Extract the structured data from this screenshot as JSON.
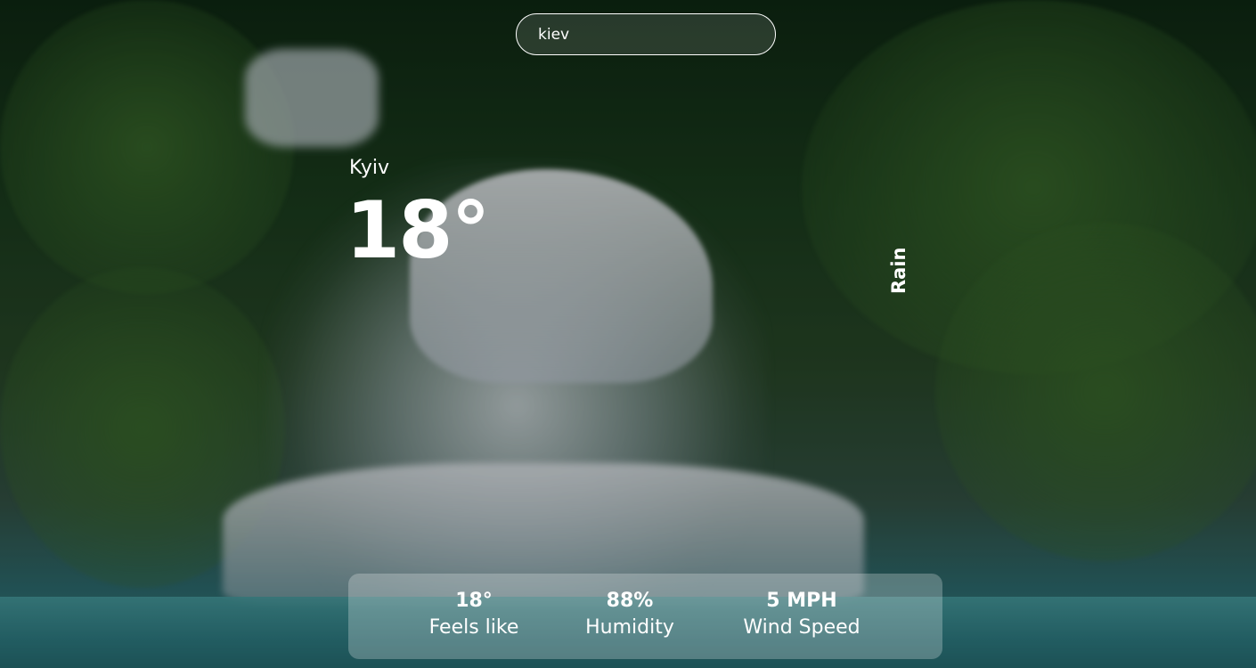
{
  "search": {
    "value": "kiev"
  },
  "weather": {
    "city": "Kyiv",
    "temperature": "18°",
    "condition": "Rain"
  },
  "details": [
    {
      "value": "18°",
      "label": "Feels like"
    },
    {
      "value": "88%",
      "label": "Humidity"
    },
    {
      "value": "5 MPH",
      "label": "Wind Speed"
    }
  ],
  "background": {
    "scene": "waterfall-jungle-photo"
  },
  "colors": {
    "text": "#ffffff",
    "panel": "rgba(255,255,255,0.25)"
  }
}
